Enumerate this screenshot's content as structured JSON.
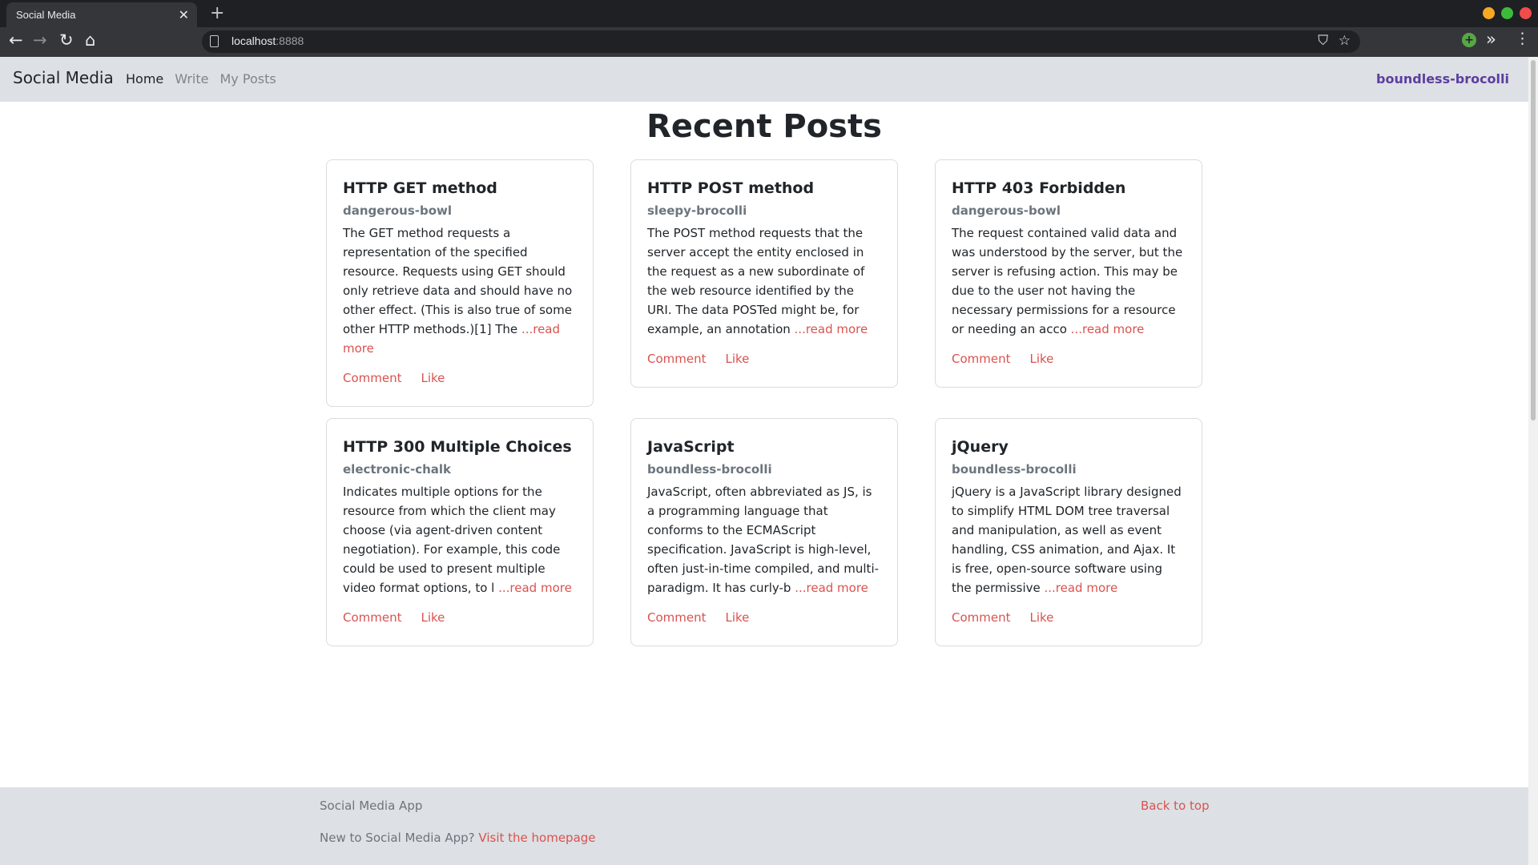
{
  "browser": {
    "tab_title": "Social Media",
    "tab_close": "✕",
    "new_tab": "+",
    "url_host": "localhost",
    "url_port": ":8888",
    "window_colors": [
      "#f6a823",
      "#3dbb3b",
      "#ef4c4a"
    ],
    "icons": [
      "back-icon",
      "forward-icon",
      "reload-icon",
      "home-icon",
      "page-info-icon",
      "pocket-icon",
      "bookmark-star-icon",
      "extension-icon",
      "extensions-overflow-icon",
      "menu-icon"
    ]
  },
  "nav": {
    "brand": "Social Media",
    "links": [
      "Home",
      "Write",
      "My Posts"
    ],
    "active": "Home",
    "user": "boundless-brocolli"
  },
  "main": {
    "title": "Recent Posts",
    "posts": [
      {
        "title": "HTTP GET method",
        "author": "dangerous-bowl",
        "excerpt": "The GET method requests a representation of the specified resource. Requests using GET should only retrieve data and should have no other effect. (This is also true of some other HTTP methods.)[1] The ",
        "read_more": "...read more",
        "comment": "Comment",
        "like": "Like"
      },
      {
        "title": "HTTP POST method",
        "author": "sleepy-brocolli",
        "excerpt": "The POST method requests that the server accept the entity enclosed in the request as a new subordinate of the web resource identified by the URI. The data POSTed might be, for example, an annotation ",
        "read_more": "...read more",
        "comment": "Comment",
        "like": "Like"
      },
      {
        "title": "HTTP 403 Forbidden",
        "author": "dangerous-bowl",
        "excerpt": "The request contained valid data and was understood by the server, but the server is refusing action. This may be due to the user not having the necessary permissions for a resource or needing an acco ",
        "read_more": "...read more",
        "comment": "Comment",
        "like": "Like"
      },
      {
        "title": "HTTP 300 Multiple Choices",
        "author": "electronic-chalk",
        "excerpt": "Indicates multiple options for the resource from which the client may choose (via agent-driven content negotiation). For example, this code could be used to present multiple video format options, to l ",
        "read_more": "...read more",
        "comment": "Comment",
        "like": "Like"
      },
      {
        "title": "JavaScript",
        "author": "boundless-brocolli",
        "excerpt": "JavaScript, often abbreviated as JS, is a programming language that conforms to the ECMAScript specification. JavaScript is high-level, often just-in-time compiled, and multi-paradigm. It has curly-b ",
        "read_more": "...read more",
        "comment": "Comment",
        "like": "Like"
      },
      {
        "title": "jQuery",
        "author": "boundless-brocolli",
        "excerpt": "jQuery is a JavaScript library designed to simplify HTML DOM tree traversal and manipulation, as well as event handling, CSS animation, and Ajax. It is free, open-source software using the permissive ",
        "read_more": "...read more",
        "comment": "Comment",
        "like": "Like"
      }
    ]
  },
  "footer": {
    "app_name": "Social Media App",
    "back_to_top": "Back to top",
    "new_text": "New to Social Media App? ",
    "homepage_link": "Visit the homepage"
  },
  "colors": {
    "accent": "#d9534f",
    "user_link": "#5a3fa0",
    "navbar_bg": "#dde0e4"
  }
}
